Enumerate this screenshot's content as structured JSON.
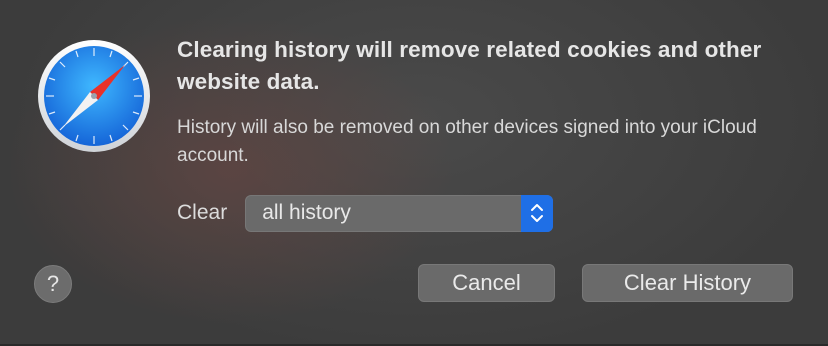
{
  "dialog": {
    "app_icon": "safari-compass-icon",
    "title": "Clearing history will remove related cookies and other website data.",
    "message": "History will also be removed on other devices signed into your iCloud account.",
    "clear_label": "Clear",
    "clear_popup": {
      "selected": "all history"
    },
    "help_label": "?",
    "cancel_label": "Cancel",
    "confirm_label": "Clear History"
  },
  "colors": {
    "accent": "#1f6fe6",
    "dialog_bg": "#3c3c3c",
    "button_bg": "#6a6a6a",
    "compass_red": "#e8322a"
  }
}
